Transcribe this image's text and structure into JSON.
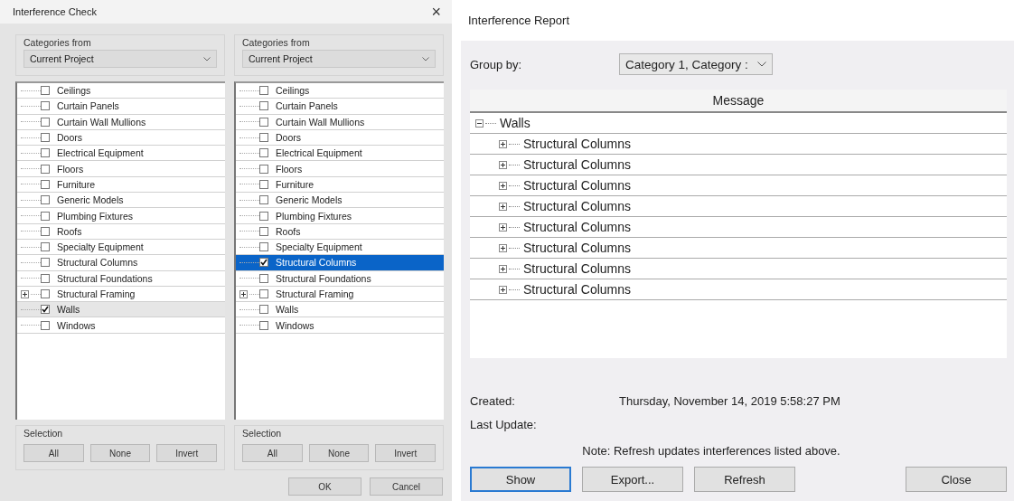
{
  "check_dialog": {
    "title": "Interference Check",
    "close": "×",
    "panels": [
      {
        "source_label": "Categories from",
        "source_value": "Current Project",
        "focused": false,
        "items": [
          {
            "label": "Ceilings",
            "checked": false,
            "selected": false,
            "expandable": false
          },
          {
            "label": "Curtain Panels",
            "checked": false,
            "selected": false,
            "expandable": false
          },
          {
            "label": "Curtain Wall Mullions",
            "checked": false,
            "selected": false,
            "expandable": false
          },
          {
            "label": "Doors",
            "checked": false,
            "selected": false,
            "expandable": false
          },
          {
            "label": "Electrical Equipment",
            "checked": false,
            "selected": false,
            "expandable": false
          },
          {
            "label": "Floors",
            "checked": false,
            "selected": false,
            "expandable": false
          },
          {
            "label": "Furniture",
            "checked": false,
            "selected": false,
            "expandable": false
          },
          {
            "label": "Generic Models",
            "checked": false,
            "selected": false,
            "expandable": false
          },
          {
            "label": "Plumbing Fixtures",
            "checked": false,
            "selected": false,
            "expandable": false
          },
          {
            "label": "Roofs",
            "checked": false,
            "selected": false,
            "expandable": false
          },
          {
            "label": "Specialty Equipment",
            "checked": false,
            "selected": false,
            "expandable": false
          },
          {
            "label": "Structural Columns",
            "checked": false,
            "selected": false,
            "expandable": false
          },
          {
            "label": "Structural Foundations",
            "checked": false,
            "selected": false,
            "expandable": false
          },
          {
            "label": "Structural Framing",
            "checked": false,
            "selected": false,
            "expandable": true
          },
          {
            "label": "Walls",
            "checked": true,
            "selected": true,
            "expandable": false
          },
          {
            "label": "Windows",
            "checked": false,
            "selected": false,
            "expandable": false
          }
        ],
        "selection_label": "Selection",
        "selection_buttons": [
          "All",
          "None",
          "Invert"
        ]
      },
      {
        "source_label": "Categories from",
        "source_value": "Current Project",
        "focused": true,
        "items": [
          {
            "label": "Ceilings",
            "checked": false,
            "selected": false,
            "expandable": false
          },
          {
            "label": "Curtain Panels",
            "checked": false,
            "selected": false,
            "expandable": false
          },
          {
            "label": "Curtain Wall Mullions",
            "checked": false,
            "selected": false,
            "expandable": false
          },
          {
            "label": "Doors",
            "checked": false,
            "selected": false,
            "expandable": false
          },
          {
            "label": "Electrical Equipment",
            "checked": false,
            "selected": false,
            "expandable": false
          },
          {
            "label": "Floors",
            "checked": false,
            "selected": false,
            "expandable": false
          },
          {
            "label": "Furniture",
            "checked": false,
            "selected": false,
            "expandable": false
          },
          {
            "label": "Generic Models",
            "checked": false,
            "selected": false,
            "expandable": false
          },
          {
            "label": "Plumbing Fixtures",
            "checked": false,
            "selected": false,
            "expandable": false
          },
          {
            "label": "Roofs",
            "checked": false,
            "selected": false,
            "expandable": false
          },
          {
            "label": "Specialty Equipment",
            "checked": false,
            "selected": false,
            "expandable": false
          },
          {
            "label": "Structural Columns",
            "checked": true,
            "selected": true,
            "expandable": false
          },
          {
            "label": "Structural Foundations",
            "checked": false,
            "selected": false,
            "expandable": false
          },
          {
            "label": "Structural Framing",
            "checked": false,
            "selected": false,
            "expandable": true
          },
          {
            "label": "Walls",
            "checked": false,
            "selected": false,
            "expandable": false
          },
          {
            "label": "Windows",
            "checked": false,
            "selected": false,
            "expandable": false
          }
        ],
        "selection_label": "Selection",
        "selection_buttons": [
          "All",
          "None",
          "Invert"
        ]
      }
    ],
    "buttons": [
      "OK",
      "Cancel"
    ]
  },
  "report_dialog": {
    "title": "Interference Report",
    "group_by_label": "Group by:",
    "group_by_value": "Category 1, Category :",
    "column": "Message",
    "tree": [
      {
        "label": "Walls",
        "expanded": true,
        "children": [
          {
            "label": "Structural Columns",
            "expanded": false
          },
          {
            "label": "Structural Columns",
            "expanded": false
          },
          {
            "label": "Structural Columns",
            "expanded": false
          },
          {
            "label": "Structural Columns",
            "expanded": false
          },
          {
            "label": "Structural Columns",
            "expanded": false
          },
          {
            "label": "Structural Columns",
            "expanded": false
          },
          {
            "label": "Structural Columns",
            "expanded": false
          },
          {
            "label": "Structural Columns",
            "expanded": false
          }
        ]
      }
    ],
    "created_label": "Created:",
    "created_value": "Thursday, November 14, 2019 5:58:27 PM",
    "last_update_label": "Last Update:",
    "note": "Note: Refresh updates interferences listed above.",
    "buttons": [
      {
        "label": "Show",
        "default": true
      },
      {
        "label": "Export...",
        "default": false
      },
      {
        "label": "Refresh",
        "default": false
      },
      {
        "label": "Close",
        "default": false
      }
    ]
  }
}
